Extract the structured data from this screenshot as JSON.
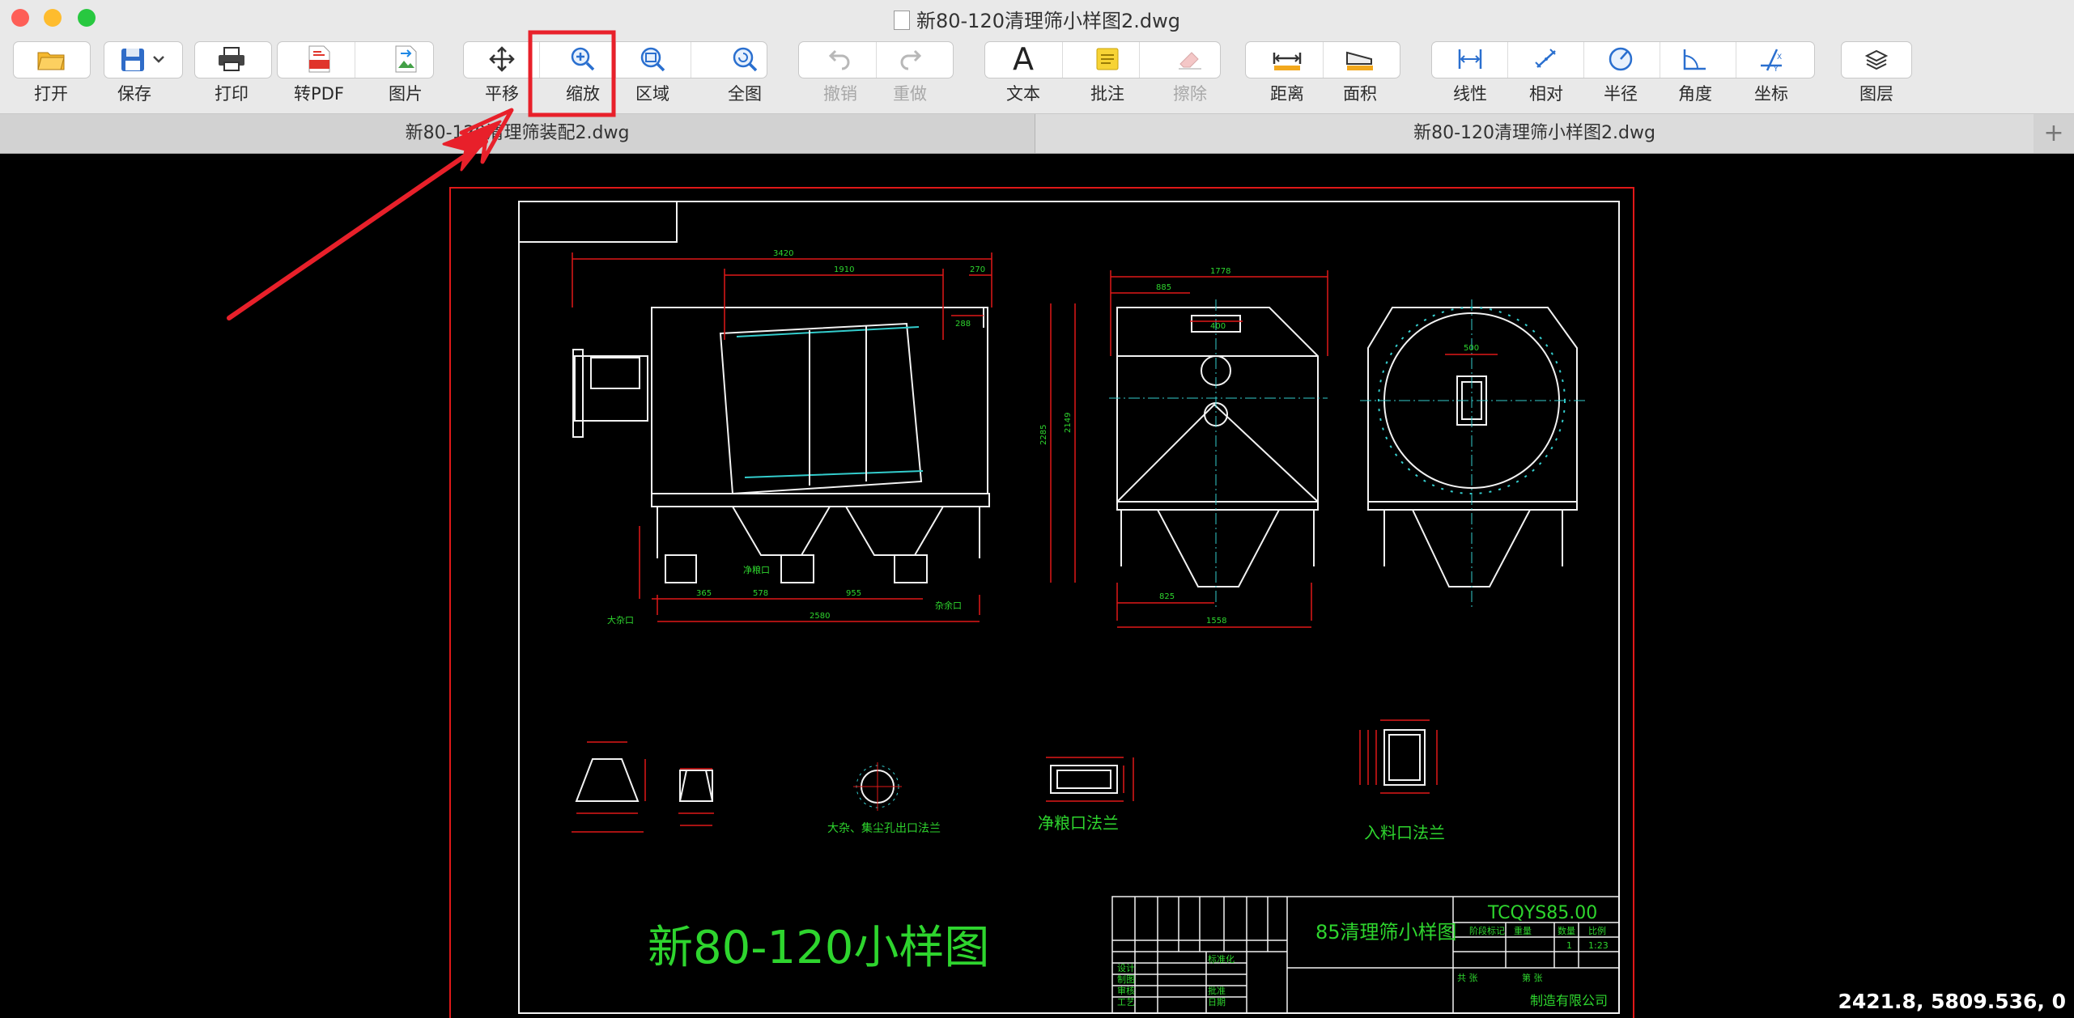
{
  "window": {
    "title": "新80-120清理筛小样图2.dwg"
  },
  "toolbar": {
    "open": "打开",
    "save": "保存",
    "print": "打印",
    "to_pdf": "转PDF",
    "image": "图片",
    "pan": "平移",
    "zoom": "缩放",
    "window_zoom": "区域",
    "zoom_extents": "全图",
    "undo": "撤销",
    "redo": "重做",
    "text": "文本",
    "note": "批注",
    "erase": "擦除",
    "distance": "距离",
    "area": "面积",
    "linear": "线性",
    "aligned": "相对",
    "radius": "半径",
    "angle": "角度",
    "coordinate": "坐标",
    "layers": "图层"
  },
  "tabs": [
    {
      "label": "新80-120清理筛装配2.dwg"
    },
    {
      "label": "新80-120清理筛小样图2.dwg"
    }
  ],
  "drawing": {
    "title_big": "新80-120小样图",
    "title_block_name": "85清理筛小样图",
    "drawing_number": "TCQYS85.00",
    "company": "制造有限公司",
    "dim_top_total": "3420",
    "dim_top_mid": "1910",
    "dim_top_right": "270",
    "dim_288": "288",
    "dim_side_width": "1778",
    "dim_side_885": "885",
    "dim_side_400": "400",
    "dim_height_2285": "2285",
    "dim_height_2149": "2149",
    "dim_825": "825",
    "dim_1558": "1558",
    "dim_2580": "2580",
    "dim_365": "365",
    "dim_578": "578",
    "dim_955": "955",
    "dim_500": "500",
    "label_clean_outlet": "净粮口",
    "label_impurity_outlet": "杂余口",
    "label_large_impurity": "大杂口",
    "caption_flange_a": "大杂、集尘孔出口法兰",
    "caption_flange_b": "净粮口法兰",
    "caption_flange_c": "入料口法兰",
    "tb_design": "设计",
    "tb_draw": "制图",
    "tb_check": "审核",
    "tb_process": "工艺",
    "tb_standard": "标准化",
    "tb_approve": "批准",
    "tb_date": "日期",
    "tb_stage": "阶段标记",
    "tb_weight": "重量",
    "tb_qty": "数量",
    "tb_scale": "比例",
    "tb_qty_val": "1",
    "tb_scale_val": "1:23",
    "tb_sheet_total": "共 张",
    "tb_sheet": "第 张"
  },
  "status": {
    "coordinates": "2421.8, 5809.536, 0"
  },
  "annotation": {
    "color": "#e8202a",
    "highlighted_tool": "zoom"
  },
  "colors": {
    "cad_green": "#2ed52e",
    "cad_red": "#e01818",
    "cad_white": "#f2f2f2",
    "cad_cyan": "#33cccc"
  }
}
